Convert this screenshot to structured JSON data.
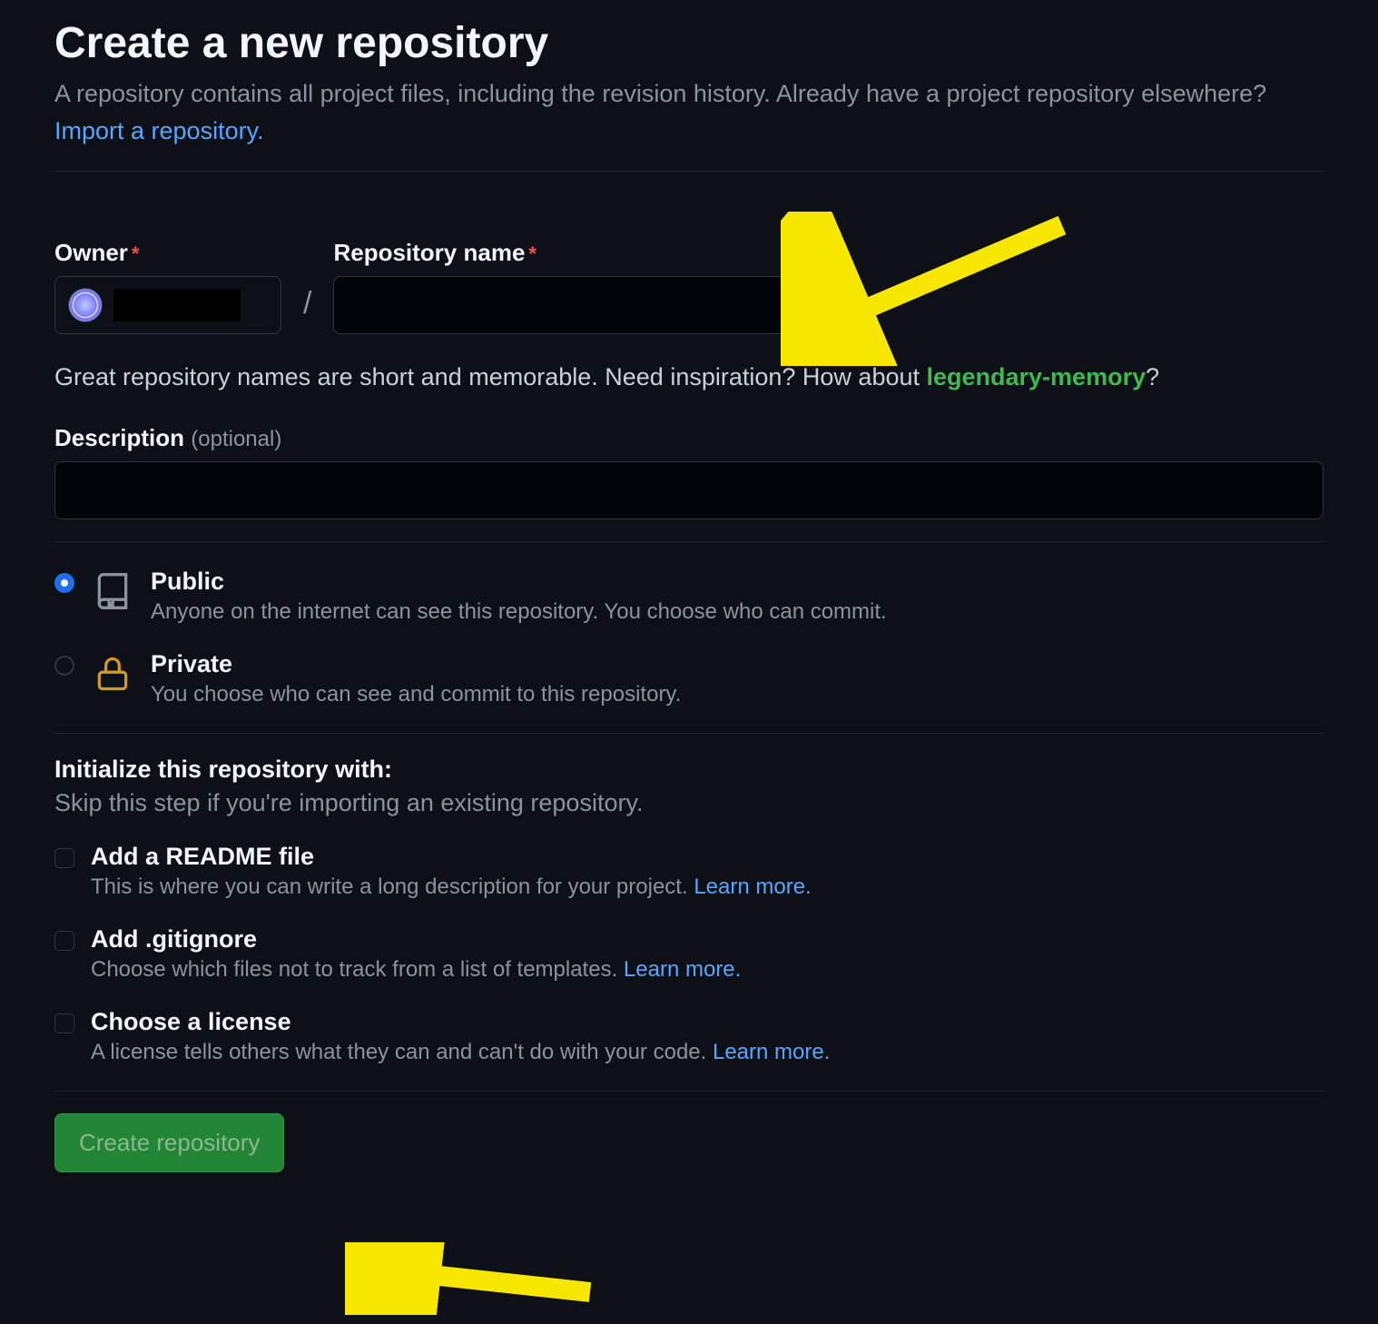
{
  "header": {
    "title": "Create a new repository",
    "subtitle_part1": "A repository contains all project files, including the revision history. Already have a project repository elsewhere? ",
    "import_link": "Import a repository."
  },
  "owner": {
    "label": "Owner"
  },
  "repo_name": {
    "label": "Repository name"
  },
  "hint": {
    "text": "Great repository names are short and memorable. Need inspiration? How about ",
    "suggestion": "legendary-memory",
    "q": "?"
  },
  "description": {
    "label": "Description",
    "optional": "(optional)"
  },
  "visibility": {
    "public": {
      "title": "Public",
      "desc": "Anyone on the internet can see this repository. You choose who can commit."
    },
    "private": {
      "title": "Private",
      "desc": "You choose who can see and commit to this repository."
    }
  },
  "initialize": {
    "heading": "Initialize this repository with:",
    "sub": "Skip this step if you're importing an existing repository.",
    "readme": {
      "title": "Add a README file",
      "desc": "This is where you can write a long description for your project. ",
      "learn": "Learn more."
    },
    "gitignore": {
      "title": "Add .gitignore",
      "desc": "Choose which files not to track from a list of templates. ",
      "learn": "Learn more."
    },
    "license": {
      "title": "Choose a license",
      "desc": "A license tells others what they can and can't do with your code. ",
      "learn": "Learn more."
    }
  },
  "submit": {
    "label": "Create repository"
  }
}
